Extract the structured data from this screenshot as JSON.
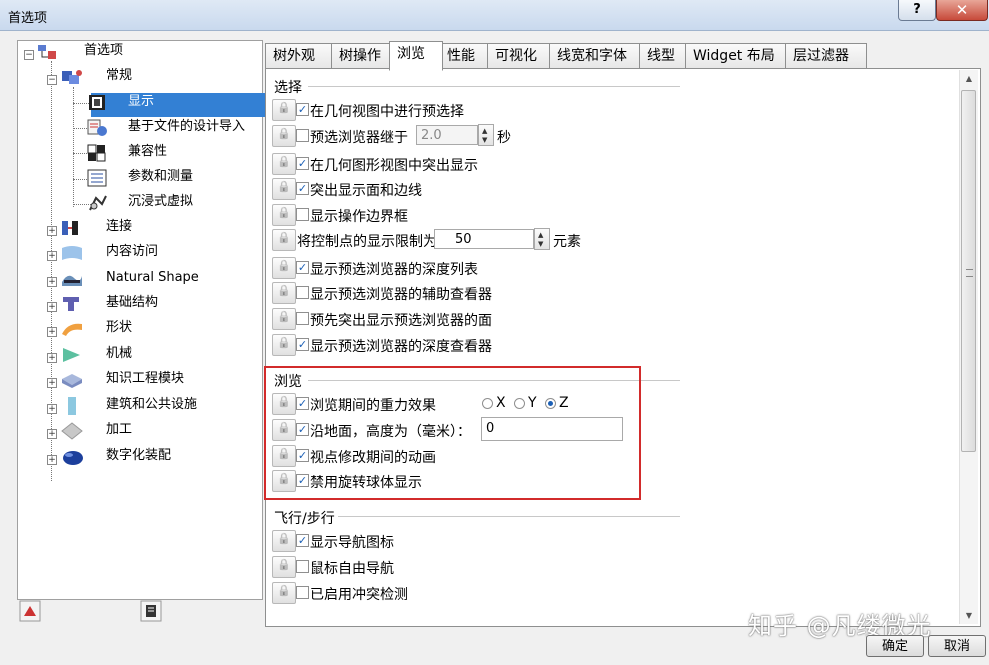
{
  "window": {
    "title": "首选项",
    "help_label": "?",
    "close_label": "✕"
  },
  "tree": {
    "items": [
      {
        "label": "首选项"
      },
      {
        "label": "常规"
      },
      {
        "label": "显示"
      },
      {
        "label": "基于文件的设计导入"
      },
      {
        "label": "兼容性"
      },
      {
        "label": "参数和测量"
      },
      {
        "label": "沉浸式虚拟"
      },
      {
        "label": "连接"
      },
      {
        "label": "内容访问"
      },
      {
        "label": "Natural Shape"
      },
      {
        "label": "基础结构"
      },
      {
        "label": "形状"
      },
      {
        "label": "机械"
      },
      {
        "label": "知识工程模块"
      },
      {
        "label": "建筑和公共设施"
      },
      {
        "label": "加工"
      },
      {
        "label": "数字化装配"
      }
    ]
  },
  "tabs": [
    {
      "label": "树外观"
    },
    {
      "label": "树操作"
    },
    {
      "label": "浏览"
    },
    {
      "label": "性能"
    },
    {
      "label": "可视化"
    },
    {
      "label": "线宽和字体"
    },
    {
      "label": "线型"
    },
    {
      "label": "Widget 布局"
    },
    {
      "label": "层过滤器"
    }
  ],
  "sections": {
    "select": {
      "title": "选择",
      "rows": [
        {
          "label": "在几何视图中进行预选择",
          "checked": true
        },
        {
          "label": "预选浏览器继于",
          "checked": false,
          "value": "2.0",
          "unit": "秒"
        },
        {
          "label": "在几何图形视图中突出显示",
          "checked": true
        },
        {
          "label": "突出显示面和边线",
          "checked": true
        },
        {
          "label": "显示操作边界框",
          "checked": false
        },
        {
          "label": "将控制点的显示限制为",
          "value": "50",
          "unit": "元素"
        },
        {
          "label": "显示预选浏览器的深度列表",
          "checked": true
        },
        {
          "label": "显示预选浏览器的辅助查看器",
          "checked": false
        },
        {
          "label": "预先突出显示预选浏览器的面",
          "checked": false
        },
        {
          "label": "显示预选浏览器的深度查看器",
          "checked": true
        }
      ]
    },
    "browse": {
      "title": "浏览",
      "rows": [
        {
          "label": "浏览期间的重力效果",
          "checked": true
        },
        {
          "label": "沿地面，高度为（毫米）：",
          "checked": true,
          "value": "0"
        },
        {
          "label": "视点修改期间的动画",
          "checked": true
        },
        {
          "label": "禁用旋转球体显示",
          "checked": true
        }
      ],
      "axes": [
        {
          "label": "X",
          "selected": false
        },
        {
          "label": "Y",
          "selected": false
        },
        {
          "label": "Z",
          "selected": true
        }
      ]
    },
    "fly": {
      "title": "飞行/步行",
      "rows": [
        {
          "label": "显示导航图标",
          "checked": true
        },
        {
          "label": "鼠标自由导航",
          "checked": false
        },
        {
          "label": "已启用冲突检测",
          "checked": false
        }
      ]
    }
  },
  "buttons": {
    "ok": "确定",
    "cancel": "取消"
  },
  "watermark": "知乎 @凡缕微光",
  "colors": {
    "selection": "#3380d4",
    "highlight_box": "#d22b2b",
    "check": "#1b5fb5"
  }
}
